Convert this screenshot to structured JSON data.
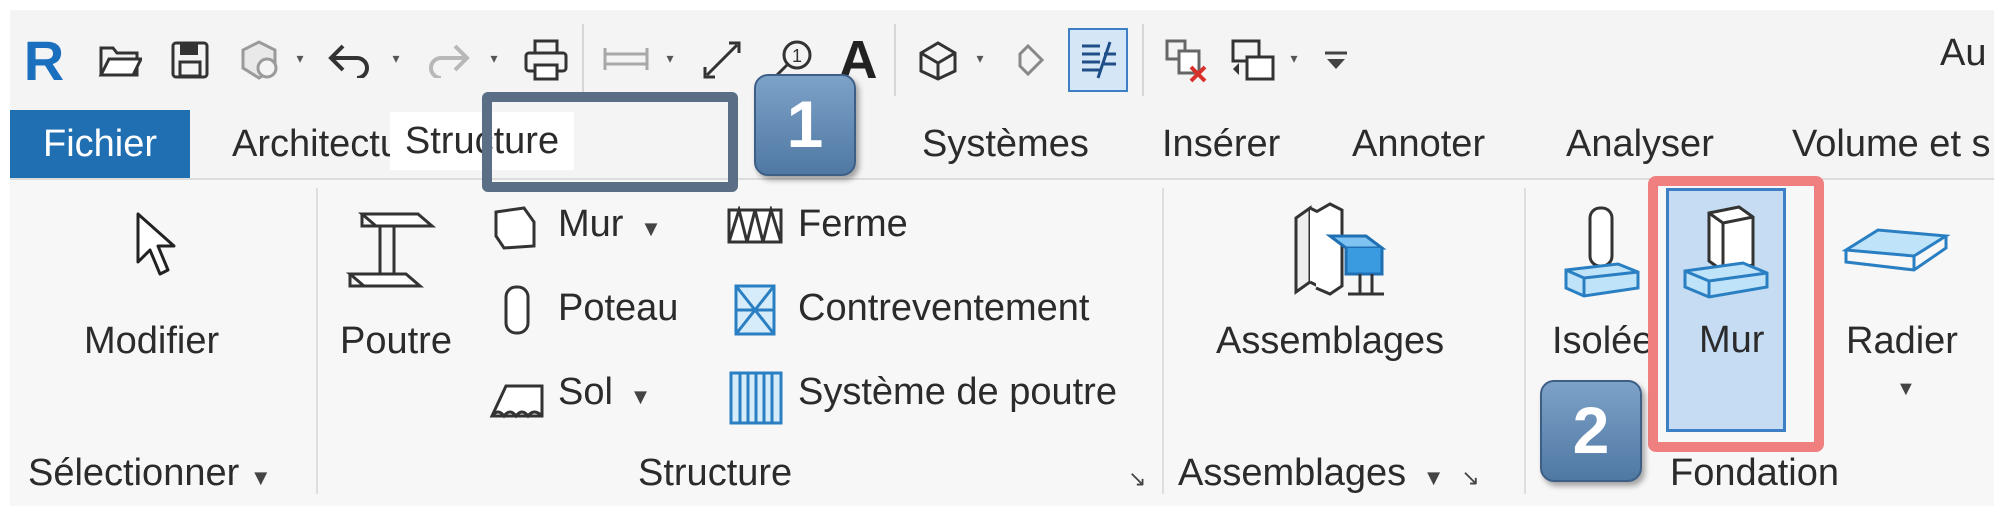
{
  "quick_access": {
    "icons": [
      "revit-logo",
      "open-icon",
      "save-icon",
      "sync-icon",
      "undo-icon",
      "redo-icon",
      "print-icon",
      "measure-icon",
      "aligned-dimension-icon",
      "tag-icon",
      "text-icon",
      "3d-view-icon",
      "section-icon",
      "thin-lines-icon",
      "close-hidden-windows-icon",
      "switch-windows-icon",
      "customize-icon"
    ],
    "logo_letter": "R",
    "text_tool_letter": "A",
    "truncated_right_text": "Au"
  },
  "tabs": {
    "file": "Fichier",
    "architecture": "Architecture",
    "structure": "Structure",
    "systems": "Systèmes",
    "insert": "Insérer",
    "annotate": "Annoter",
    "analyze": "Analyser",
    "massing": "Volume et s",
    "active": "Structure"
  },
  "panels": {
    "select": {
      "modify_label": "Modifier",
      "footer": "Sélectionner"
    },
    "structure": {
      "beam_label": "Poutre",
      "wall_label": "Mur",
      "column_label": "Poteau",
      "floor_label": "Sol",
      "truss_label": "Ferme",
      "brace_label": "Contreventement",
      "beam_system_label": "Système de poutre",
      "footer": "Structure"
    },
    "assemblies": {
      "label": "Assemblages",
      "footer": "Assemblages"
    },
    "foundation": {
      "isolated_label": "Isolée",
      "wall_label": "Mur",
      "slab_label": "Radier",
      "footer": "Fondation"
    }
  },
  "callouts": {
    "step1": "1",
    "step2": "2",
    "highlight_color": "#f08080",
    "tab_box_color": "#5a6e86"
  },
  "colors": {
    "file_tab_bg": "#1f6fb2",
    "selected_tool_bg": "#c5dcf2",
    "selected_tool_border": "#3c7fc4"
  }
}
